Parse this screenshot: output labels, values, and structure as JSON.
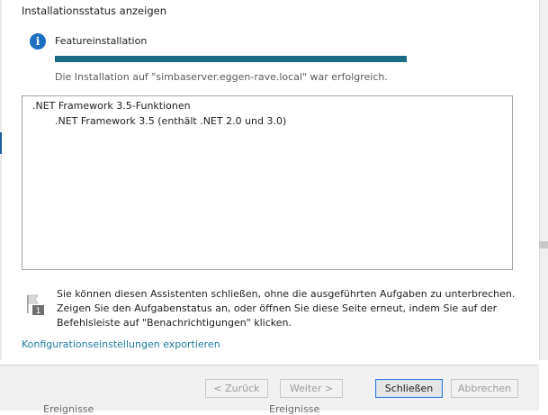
{
  "header": {
    "title": "Installationsstatus anzeigen"
  },
  "progress": {
    "icon": "info-icon",
    "label": "Featureinstallation",
    "fraction": 1.0,
    "bar_color": "#1a6b85",
    "status": "Die Installation auf \"simbaserver.eggen-rave.local\" war erfolgreich."
  },
  "results": {
    "items": [
      {
        "label": ".NET Framework 3.5-Funktionen"
      },
      {
        "label": ".NET Framework 3.5 (enthält .NET 2.0 und 3.0)"
      }
    ]
  },
  "note": {
    "icon": "notification-flag-icon",
    "badge": "1",
    "lines": [
      "Sie können diesen Assistenten schließen, ohne die ausgeführten Aufgaben zu unterbrechen.",
      "Zeigen Sie den Aufgabenstatus an, oder öffnen Sie diese Seite erneut, indem Sie auf der",
      "Befehlsleiste auf \"Benachrichtigungen\" klicken."
    ]
  },
  "export_link": "Konfigurationseinstellungen exportieren",
  "buttons": {
    "back": "< Zurück",
    "next": "Weiter >",
    "close": "Schließen",
    "cancel": "Abbrechen"
  },
  "background_fragments": [
    "Ereignisse",
    "Ereignisse"
  ]
}
